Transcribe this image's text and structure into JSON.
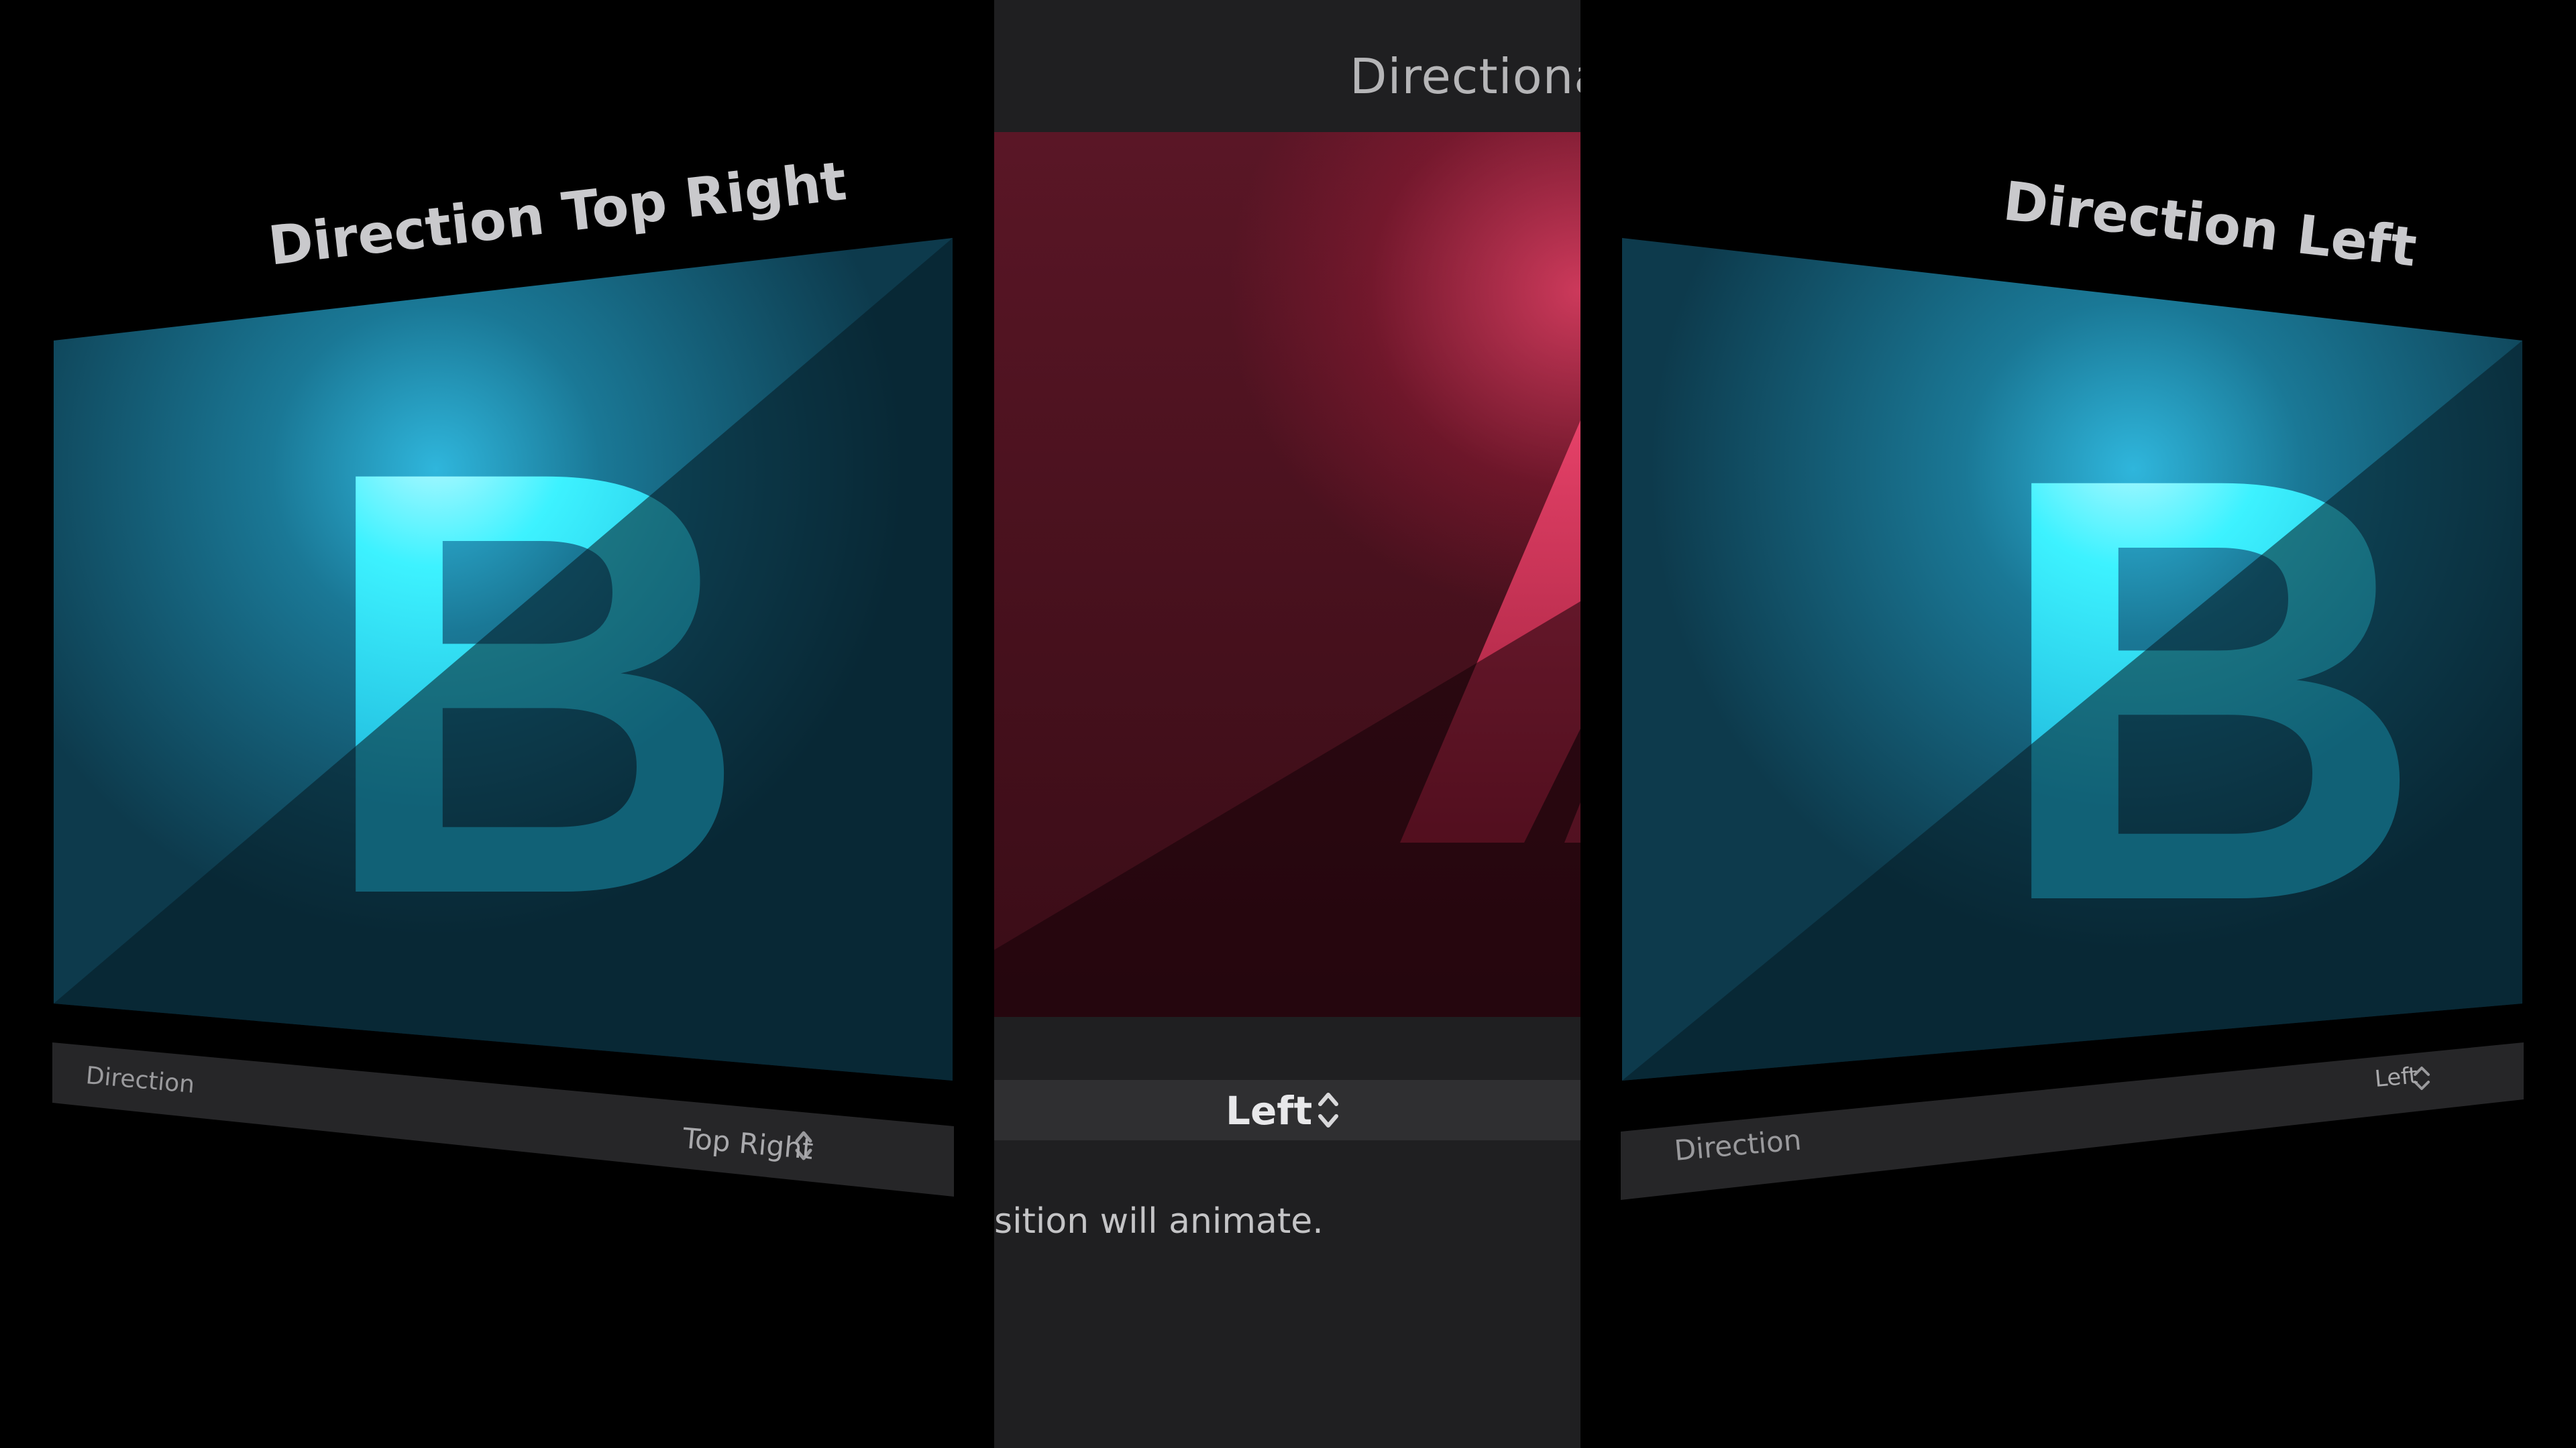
{
  "center": {
    "title": "Directiona",
    "selected_value": "Left",
    "description": "sition will animate.",
    "preview_letter": "A"
  },
  "left_panel": {
    "title": "Direction Top Right",
    "letter": "B",
    "parameter_label": "Direction",
    "parameter_value": "Top Right"
  },
  "right_panel": {
    "title": "Direction Left",
    "letter": "B",
    "parameter_label": "Direction",
    "parameter_value": "Left"
  },
  "colors": {
    "background": "#000000",
    "strip": "#1f1f21",
    "cyan_accent": "#3df2ff",
    "panel_teal": "#145a70",
    "red_accent": "#e0405f"
  },
  "icons": {
    "popup_chevron": "up-down-chevron-icon"
  }
}
